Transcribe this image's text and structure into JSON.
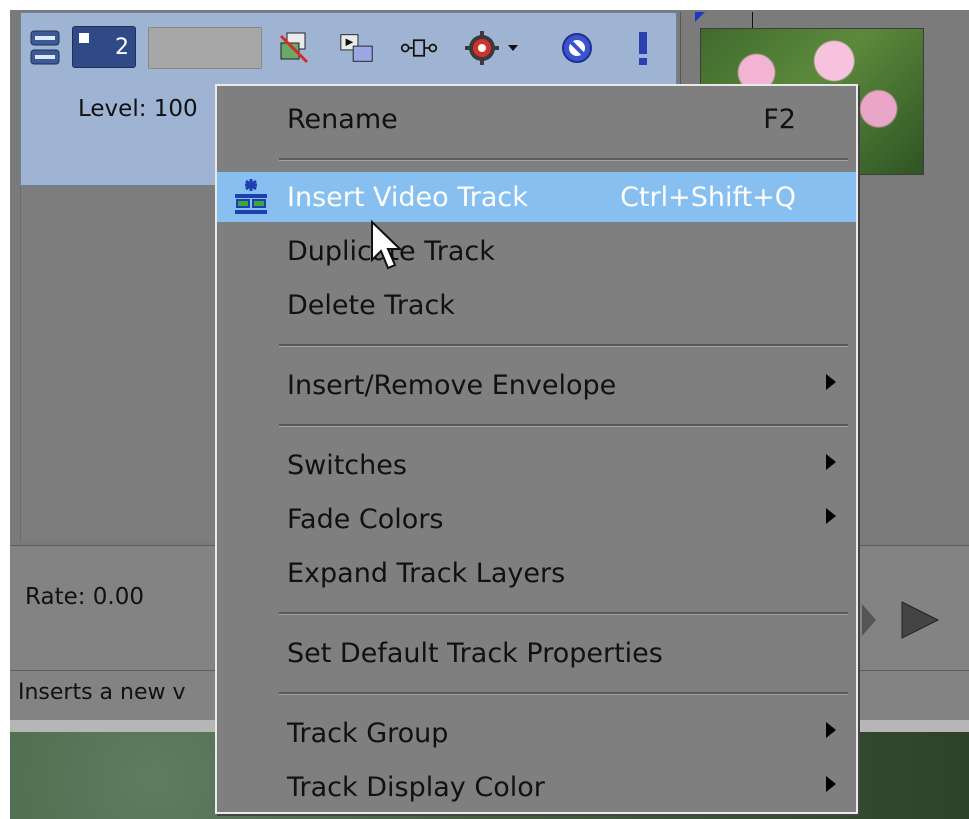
{
  "track": {
    "number": "2",
    "level_label": "Level: 100",
    "rate_label": "Rate: 0.00",
    "status_text": "Inserts a new v"
  },
  "toolbar_icons": [
    "track-minimize-icon",
    "track-motion-icon",
    "compositing-icon",
    "track-fx-icon",
    "settings-gear-icon",
    "mute-icon",
    "solo-icon"
  ],
  "menu": {
    "items": [
      {
        "label": "Rename",
        "shortcut": "F2"
      },
      {
        "label": "Insert Video Track",
        "shortcut": "Ctrl+Shift+Q",
        "highlighted": true,
        "icon": "insert-video-track-icon"
      },
      {
        "label": "Duplicate Track"
      },
      {
        "label": "Delete Track"
      },
      {
        "label": "Insert/Remove Envelope",
        "submenu": true
      },
      {
        "label": "Switches",
        "submenu": true
      },
      {
        "label": "Fade Colors",
        "submenu": true
      },
      {
        "label": "Expand Track Layers"
      },
      {
        "label": "Set Default Track Properties"
      },
      {
        "label": "Track Group",
        "submenu": true
      },
      {
        "label": "Track Display Color",
        "submenu": true
      }
    ]
  },
  "colors": {
    "track_header_bg": "#9eb4d2",
    "menu_bg": "#7f7f7f",
    "menu_highlight": "#86bff0"
  }
}
